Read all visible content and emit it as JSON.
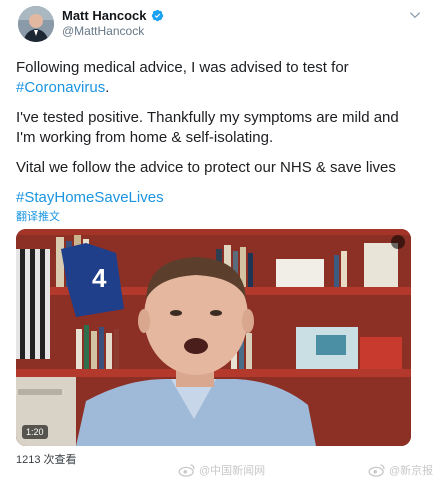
{
  "user": {
    "display_name": "Matt Hancock",
    "handle": "@MattHancock",
    "verified": true
  },
  "tweet": {
    "line1": "Following medical advice, I was advised to test for",
    "hashtag1": "#Coronavirus",
    "line1_end": ".",
    "line2": "I've tested positive. Thankfully my symptoms are mild and I'm working from home & self-isolating.",
    "line3": "Vital we follow the advice to protect our NHS & save lives",
    "hashtag2": "#StayHomeSaveLives"
  },
  "translate_label": "翻译推文",
  "video": {
    "duration": "1:20"
  },
  "views_label": "1213 次查看",
  "watermarks": [
    {
      "text": "@中国新闻网"
    },
    {
      "text": "@新京报"
    }
  ],
  "colors": {
    "link": "#1b95e0",
    "verified": "#1da1f2",
    "text": "#14171a",
    "secondary": "#657786"
  },
  "icons": {
    "verified": "verified-badge-icon",
    "more": "chevron-down-icon",
    "video_menu": "video-menu-icon",
    "watermark": "weibo-logo-icon"
  }
}
